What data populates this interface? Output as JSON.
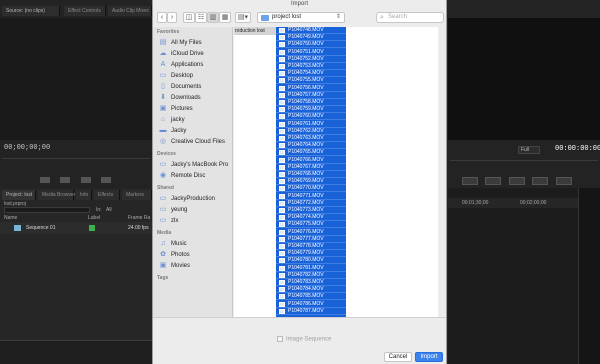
{
  "editor": {
    "source_tab": "Source: (no clips)",
    "effect_controls_tab": "Effect Controls",
    "audio_mixer_tab": "Audio Clip Mixer:",
    "source_timecode": "00;00;00;00",
    "program_timecode": "00:00:00:00",
    "zoom_value": "Full",
    "project_tabs": [
      "Project: lost",
      "Media Browser",
      "Info",
      "Effects",
      "Markers"
    ],
    "project_file": "lost.prproj",
    "in_label": "In:",
    "in_value": "All",
    "columns": {
      "name": "Name",
      "label": "Label",
      "frame_rate": "Frame Ra"
    },
    "sequence": {
      "name": "Sequence 01",
      "frame_rate": "24.00 fps",
      "label_color": "#3fb14a"
    },
    "timeline_times": [
      "00;01;30;00",
      "00;02;00;00"
    ]
  },
  "dialog": {
    "title": "Import",
    "path": "project lost",
    "search_placeholder": "Search",
    "view_buttons": [
      "◫",
      "☷",
      "▥",
      "▦"
    ],
    "sidebar": {
      "favorites_header": "Favorites",
      "favorites": [
        {
          "label": "All My Files",
          "icon": "all-files-icon"
        },
        {
          "label": "iCloud Drive",
          "icon": "cloud-icon"
        },
        {
          "label": "Applications",
          "icon": "applications-icon"
        },
        {
          "label": "Desktop",
          "icon": "desktop-icon"
        },
        {
          "label": "Documents",
          "icon": "documents-icon"
        },
        {
          "label": "Downloads",
          "icon": "downloads-icon"
        },
        {
          "label": "Pictures",
          "icon": "pictures-icon"
        },
        {
          "label": "jacky",
          "icon": "home-icon"
        },
        {
          "label": "Jacky",
          "icon": "folder-icon"
        },
        {
          "label": "Creative Cloud Files",
          "icon": "creative-cloud-icon"
        }
      ],
      "devices_header": "Devices",
      "devices": [
        {
          "label": "Jacky's MacBook Pro",
          "icon": "laptop-icon"
        },
        {
          "label": "Remote Disc",
          "icon": "disc-icon"
        }
      ],
      "shared_header": "Shared",
      "shared": [
        {
          "label": "JackyProduction",
          "icon": "network-icon"
        },
        {
          "label": "yeung",
          "icon": "network-icon"
        },
        {
          "label": "zlx",
          "icon": "network-icon"
        }
      ],
      "media_header": "Media",
      "media": [
        {
          "label": "Music",
          "icon": "music-icon"
        },
        {
          "label": "Photos",
          "icon": "photos-icon"
        },
        {
          "label": "Movies",
          "icon": "movies-icon"
        }
      ],
      "tags_header": "Tags"
    },
    "column1_item": "roduction lost",
    "files": [
      "P1040748.MOV",
      "P1040749.MOV",
      "P1040750.MOV",
      "P1040751.MOV",
      "P1040752.MOV",
      "P1040753.MOV",
      "P1040754.MOV",
      "P1040755.MOV",
      "P1040756.MOV",
      "P1040757.MOV",
      "P1040758.MOV",
      "P1040759.MOV",
      "P1040760.MOV",
      "P1040761.MOV",
      "P1040762.MOV",
      "P1040763.MOV",
      "P1040764.MOV",
      "P1040765.MOV",
      "P1040766.MOV",
      "P1040767.MOV",
      "P1040768.MOV",
      "P1040769.MOV",
      "P1040770.MOV",
      "P1040771.MOV",
      "P1040772.MOV",
      "P1040773.MOV",
      "P1040774.MOV",
      "P1040775.MOV",
      "P1040776.MOV",
      "P1040777.MOV",
      "P1040778.MOV",
      "P1040779.MOV",
      "P1040780.MOV",
      "P1040781.MOV",
      "P1040782.MOV",
      "P1040783.MOV",
      "P1040784.MOV",
      "P1040785.MOV",
      "P1040786.MOV",
      "P1040787.MOV"
    ],
    "image_sequence_label": "Image Sequence",
    "cancel_label": "Cancel",
    "import_label": "Import",
    "selection_color": "#1a62d8"
  }
}
